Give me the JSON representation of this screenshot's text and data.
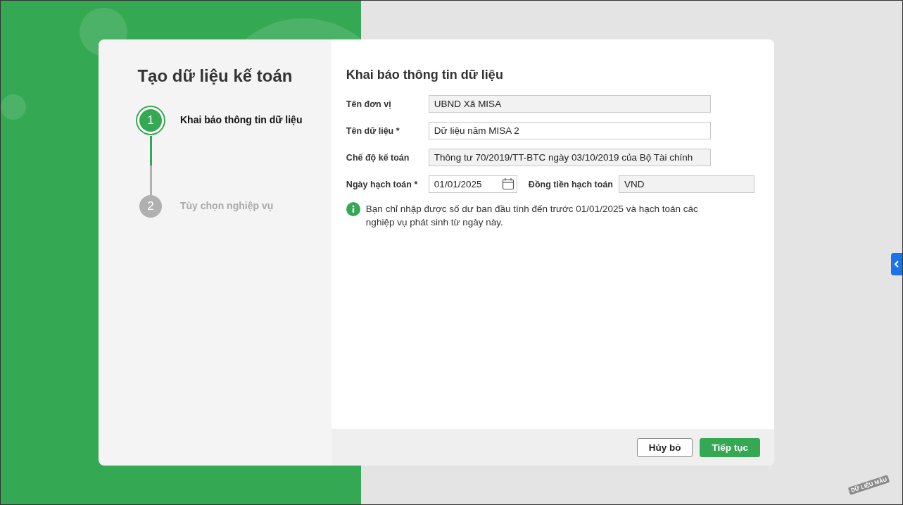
{
  "wizard": {
    "title": "Tạo dữ liệu kế toán",
    "steps": [
      {
        "number": "1",
        "label": "Khai báo thông tin dữ liệu",
        "active": true
      },
      {
        "number": "2",
        "label": "Tùy chọn nghiệp vụ",
        "active": false
      }
    ]
  },
  "form": {
    "title": "Khai báo thông tin dữ liệu",
    "fields": [
      {
        "label": "Tên đơn vị",
        "value": "UBND Xã MISA",
        "disabled": true
      },
      {
        "label": "Tên dữ liệu *",
        "value": "Dữ liệu năm MISA 2",
        "disabled": false
      },
      {
        "label": "Chế độ kế toán",
        "value": "Thông tư 70/2019/TT-BTC ngày 03/10/2019 của Bộ Tài chính",
        "disabled": true
      }
    ],
    "date": {
      "label": "Ngày hạch toán *",
      "value": "01/01/2025",
      "disabled": false
    },
    "currency": {
      "label": "Đồng tiền hạch toán",
      "value": "VND",
      "disabled": true
    },
    "note": "Bạn chỉ nhập được số dư ban đầu tính đến trước 01/01/2025 và hạch toán các nghiệp vụ phát sinh từ ngày này."
  },
  "buttons": {
    "cancel": "Hủy bỏ",
    "next": "Tiếp tục"
  },
  "stamp": "DỮ LIỆU MẪU"
}
